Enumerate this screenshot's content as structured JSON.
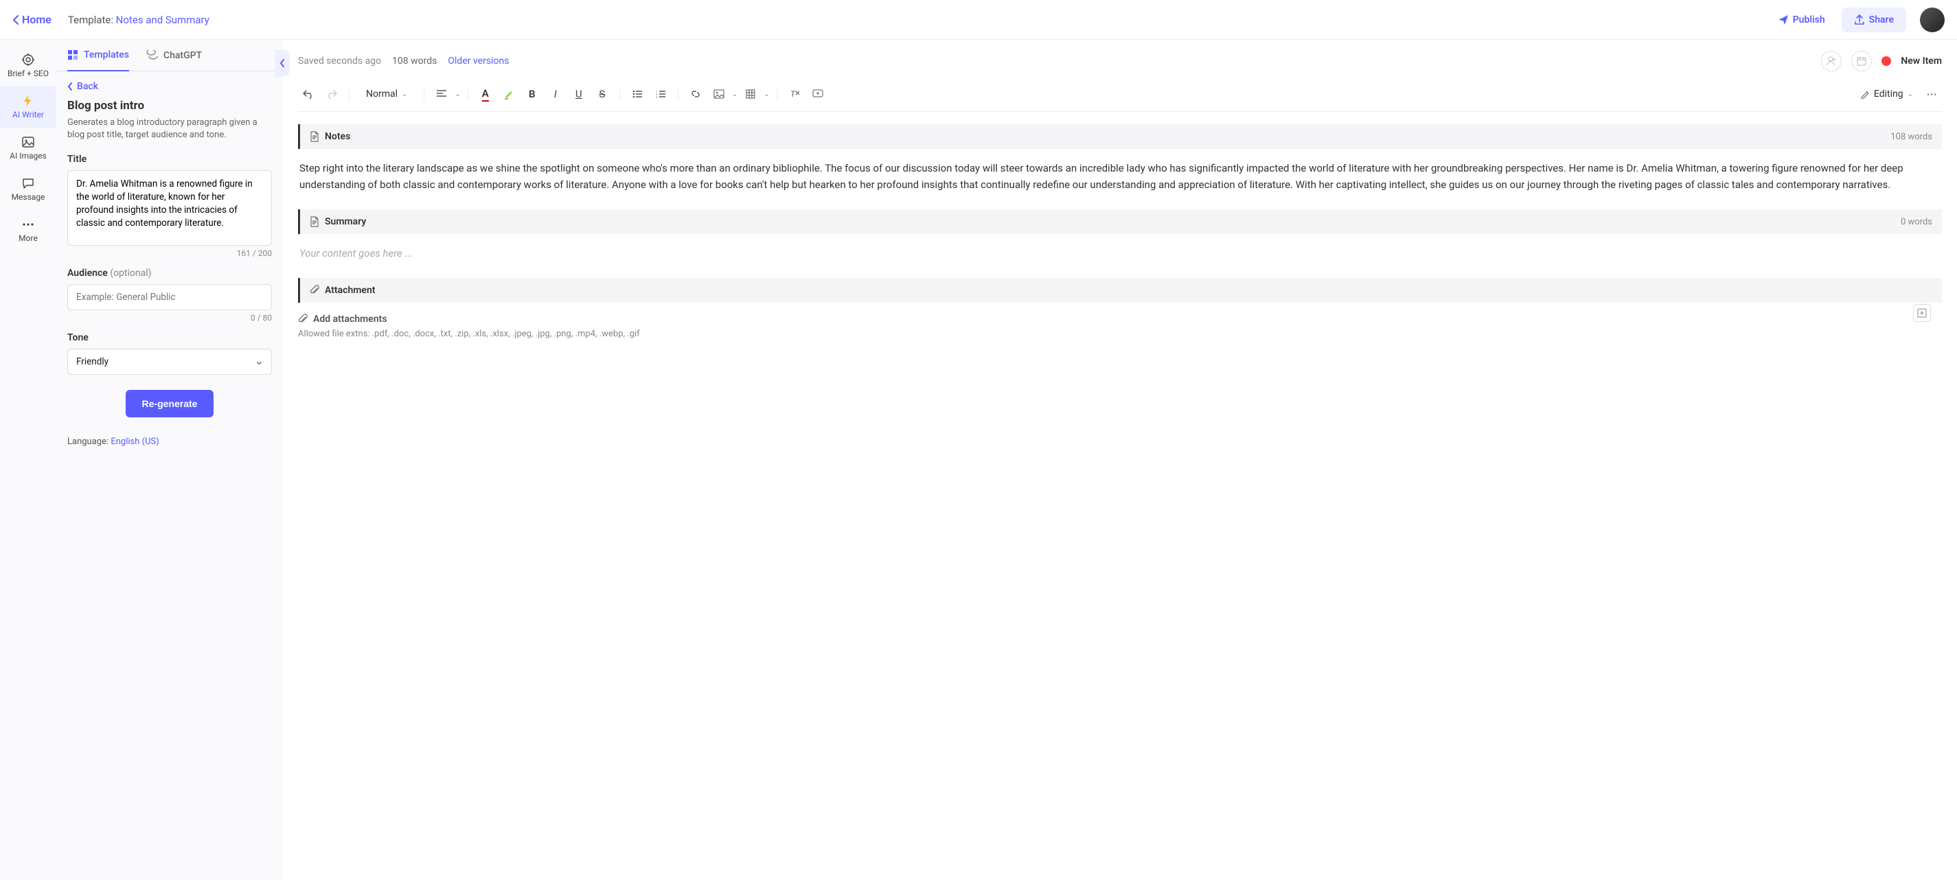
{
  "header": {
    "home": "Home",
    "template_prefix": "Template: ",
    "template_name": "Notes and Summary",
    "publish": "Publish",
    "share": "Share"
  },
  "nav": {
    "brief": "Brief + SEO",
    "writer": "AI Writer",
    "images": "AI Images",
    "message": "Message",
    "more": "More"
  },
  "panel": {
    "tab_templates": "Templates",
    "tab_chatgpt": "ChatGPT",
    "back": "Back",
    "title": "Blog post intro",
    "desc": "Generates a blog introductory paragraph given a blog post title, target audience and tone.",
    "title_label": "Title",
    "title_value": "Dr. Amelia Whitman is a renowned figure in the world of literature, known for her profound insights into the intricacies of classic and contemporary literature.",
    "title_counter": "161 / 200",
    "audience_label": "Audience",
    "audience_opt": "(optional)",
    "audience_placeholder": "Example: General Public",
    "audience_counter": "0 / 80",
    "tone_label": "Tone",
    "tone_value": "Friendly",
    "regenerate": "Re-generate",
    "language_prefix": "Language: ",
    "language_value": "English (US)"
  },
  "editor": {
    "saved": "Saved seconds ago",
    "words": "108 words",
    "older": "Older versions",
    "new_item": "New Item",
    "format": "Normal",
    "mode": "Editing",
    "notes_title": "Notes",
    "notes_words": "108 words",
    "notes_body": "Step right into the literary landscape as we shine the spotlight on someone who's more than an ordinary bibliophile. The focus of our discussion today will steer towards an incredible lady who has significantly impacted the world of literature with her groundbreaking perspectives. Her name is Dr. Amelia Whitman, a towering figure renowned for her deep understanding of both classic and contemporary works of literature. Anyone with a love for books can't help but hearken to her profound insights that continually redefine our understanding and appreciation of literature. With her captivating intellect, she guides us on our journey through the riveting pages of classic tales and contemporary narratives.",
    "summary_title": "Summary",
    "summary_words": "0 words",
    "summary_placeholder": "Your content goes here ...",
    "attachment_title": "Attachment",
    "add_attachments": "Add attachments",
    "allowed_ext": "Allowed file extns: .pdf, .doc, .docx, .txt, .zip, .xls, .xlsx, .jpeg, .jpg, .png, .mp4, .webp, .gif"
  }
}
